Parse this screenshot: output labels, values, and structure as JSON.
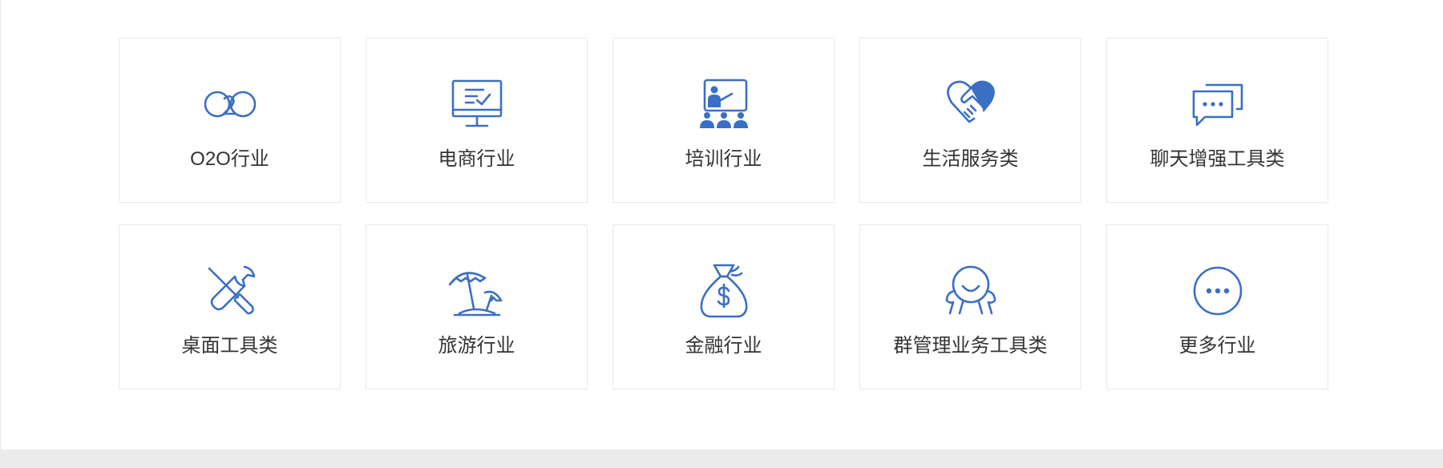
{
  "accent_color": "#3b6fc4",
  "industries": [
    {
      "label": "O2O行业",
      "icon": "o2o-icon"
    },
    {
      "label": "电商行业",
      "icon": "monitor-checklist-icon"
    },
    {
      "label": "培训行业",
      "icon": "presentation-audience-icon"
    },
    {
      "label": "生活服务类",
      "icon": "heart-handshake-icon"
    },
    {
      "label": "聊天增强工具类",
      "icon": "chat-bubbles-icon"
    },
    {
      "label": "桌面工具类",
      "icon": "wrench-screwdriver-icon"
    },
    {
      "label": "旅游行业",
      "icon": "beach-umbrella-icon"
    },
    {
      "label": "金融行业",
      "icon": "money-bag-icon"
    },
    {
      "label": "群管理业务工具类",
      "icon": "happy-face-icon"
    },
    {
      "label": "更多行业",
      "icon": "more-dots-icon"
    }
  ]
}
